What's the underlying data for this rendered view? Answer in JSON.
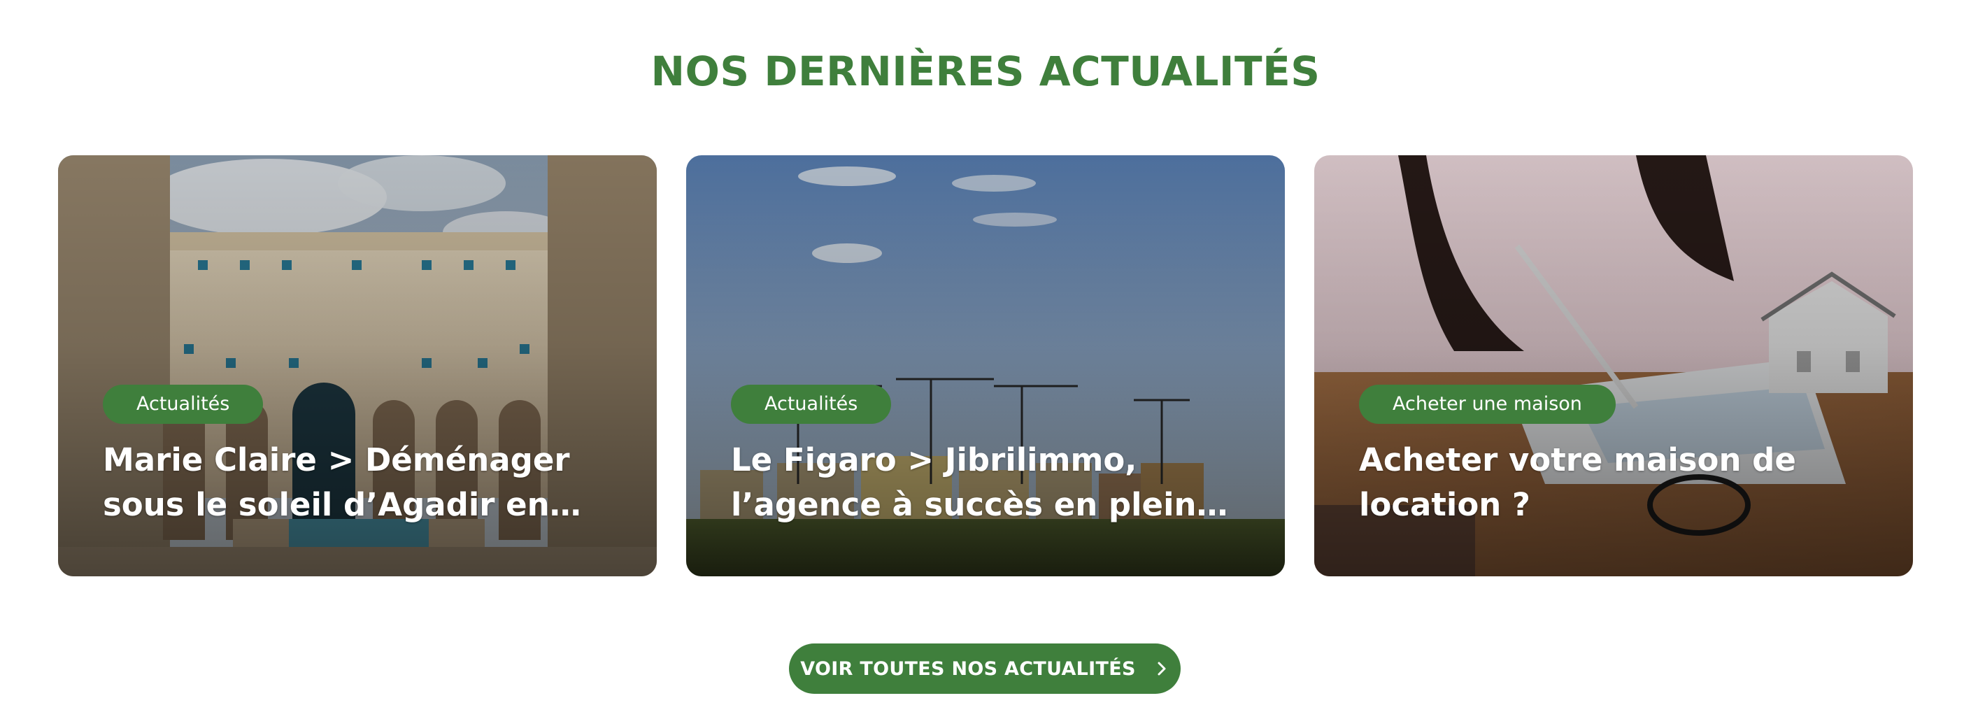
{
  "section": {
    "title": "NOS DERNIÈRES ACTUALITÉS",
    "accent_color": "#3f7f3c"
  },
  "cards": [
    {
      "category": "Actualités",
      "title": "Marie Claire > Déménager sous le soleil d’Agadir en toute sérénité",
      "image": "moroccan-courtyard-building-photo"
    },
    {
      "category": "Actualités",
      "title": "Le Figaro > Jibrilimmo, l’agence à succès en plein essor",
      "image": "construction-site-cranes-photo"
    },
    {
      "category": "Acheter une maison",
      "title": "Acheter votre maison de location ?",
      "image": "woman-signing-documents-house-model-photo"
    }
  ],
  "cta": {
    "label": "VOIR TOUTES NOS ACTUALITÉS",
    "icon": "chevron-right-icon"
  }
}
